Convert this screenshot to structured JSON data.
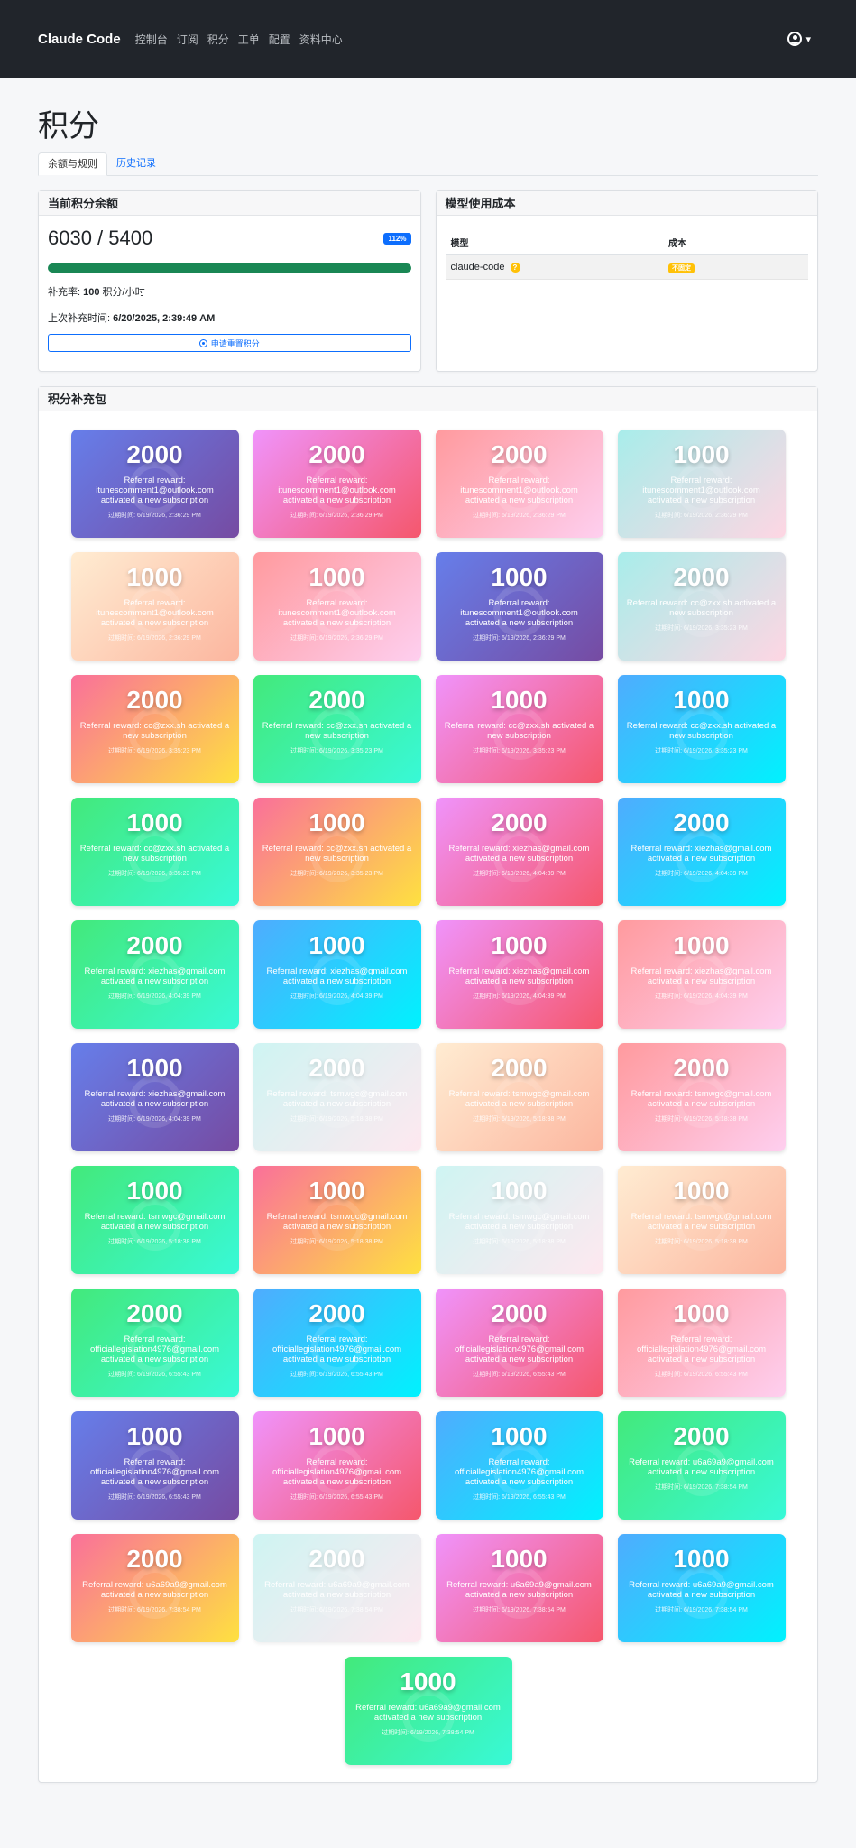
{
  "nav": {
    "brand": "Claude Code",
    "links": [
      "控制台",
      "订阅",
      "积分",
      "工单",
      "配置",
      "资料中心"
    ]
  },
  "page": {
    "title": "积分",
    "tabs": [
      "余额与规则",
      "历史记录"
    ]
  },
  "balance_card": {
    "header": "当前积分余额",
    "balance": "6030 / 5400",
    "percent_badge": "112%",
    "progress_fraction": 1.0,
    "rate_label": "补充率:",
    "rate_value": "100",
    "rate_unit": "积分/小时",
    "last_refill_label": "上次补充时间:",
    "last_refill_value": "6/20/2025, 2:39:49 AM",
    "reset_button": "申请重置积分"
  },
  "cost_card": {
    "header": "模型使用成本",
    "col_model": "模型",
    "col_cost": "成本",
    "rows": [
      {
        "model": "claude-code",
        "help": "?",
        "cost": "不固定"
      }
    ]
  },
  "packs": {
    "header": "积分补充包",
    "items": [
      {
        "amount": "2000",
        "desc": "Referral reward: itunescomment1@outlook.com activated a new subscription",
        "expiry": "过期时间: 6/19/2026, 2:36:29 PM",
        "g": "purple",
        "muted": false
      },
      {
        "amount": "2000",
        "desc": "Referral reward: itunescomment1@outlook.com activated a new subscription",
        "expiry": "过期时间: 6/19/2026, 2:36:29 PM",
        "g": "magenta",
        "muted": false
      },
      {
        "amount": "2000",
        "desc": "Referral reward: itunescomment1@outlook.com activated a new subscription",
        "expiry": "过期时间: 6/19/2026, 2:36:29 PM",
        "g": "pink",
        "muted": false
      },
      {
        "amount": "1000",
        "desc": "Referral reward: itunescomment1@outlook.com activated a new subscription",
        "expiry": "过期时间: 6/19/2026, 2:36:29 PM",
        "g": "mint",
        "muted": false
      },
      {
        "amount": "1000",
        "desc": "Referral reward: itunescomment1@outlook.com activated a new subscription",
        "expiry": "过期时间: 6/19/2026, 2:36:29 PM",
        "g": "peach",
        "muted": false
      },
      {
        "amount": "1000",
        "desc": "Referral reward: itunescomment1@outlook.com activated a new subscription",
        "expiry": "过期时间: 6/19/2026, 2:36:29 PM",
        "g": "pink",
        "muted": false
      },
      {
        "amount": "1000",
        "desc": "Referral reward: itunescomment1@outlook.com activated a new subscription",
        "expiry": "过期时间: 6/19/2026, 2:36:29 PM",
        "g": "purple",
        "muted": false
      },
      {
        "amount": "2000",
        "desc": "Referral reward: cc@zxx.sh activated a new subscription",
        "expiry": "过期时间: 6/19/2026, 3:35:23 PM",
        "g": "mint",
        "muted": false
      },
      {
        "amount": "2000",
        "desc": "Referral reward: cc@zxx.sh activated a new subscription",
        "expiry": "过期时间: 6/19/2026, 3:35:23 PM",
        "g": "sunset",
        "muted": false
      },
      {
        "amount": "2000",
        "desc": "Referral reward: cc@zxx.sh activated a new subscription",
        "expiry": "过期时间: 6/19/2026, 3:35:23 PM",
        "g": "green",
        "muted": false
      },
      {
        "amount": "1000",
        "desc": "Referral reward: cc@zxx.sh activated a new subscription",
        "expiry": "过期时间: 6/19/2026, 3:35:23 PM",
        "g": "magenta",
        "muted": false
      },
      {
        "amount": "1000",
        "desc": "Referral reward: cc@zxx.sh activated a new subscription",
        "expiry": "过期时间: 6/19/2026, 3:35:23 PM",
        "g": "cyan",
        "muted": false
      },
      {
        "amount": "1000",
        "desc": "Referral reward: cc@zxx.sh activated a new subscription",
        "expiry": "过期时间: 6/19/2026, 3:35:23 PM",
        "g": "green",
        "muted": false
      },
      {
        "amount": "1000",
        "desc": "Referral reward: cc@zxx.sh activated a new subscription",
        "expiry": "过期时间: 6/19/2026, 3:35:23 PM",
        "g": "sunset",
        "muted": false
      },
      {
        "amount": "2000",
        "desc": "Referral reward: xiezhas@gmail.com activated a new subscription",
        "expiry": "过期时间: 6/19/2026, 4:04:39 PM",
        "g": "magenta",
        "muted": false
      },
      {
        "amount": "2000",
        "desc": "Referral reward: xiezhas@gmail.com activated a new subscription",
        "expiry": "过期时间: 6/19/2026, 4:04:39 PM",
        "g": "cyan",
        "muted": false
      },
      {
        "amount": "2000",
        "desc": "Referral reward: xiezhas@gmail.com activated a new subscription",
        "expiry": "过期时间: 6/19/2026, 4:04:39 PM",
        "g": "green",
        "muted": false
      },
      {
        "amount": "1000",
        "desc": "Referral reward: xiezhas@gmail.com activated a new subscription",
        "expiry": "过期时间: 6/19/2026, 4:04:39 PM",
        "g": "cyan",
        "muted": false
      },
      {
        "amount": "1000",
        "desc": "Referral reward: xiezhas@gmail.com activated a new subscription",
        "expiry": "过期时间: 6/19/2026, 4:04:39 PM",
        "g": "magenta",
        "muted": false
      },
      {
        "amount": "1000",
        "desc": "Referral reward: xiezhas@gmail.com activated a new subscription",
        "expiry": "过期时间: 6/19/2026, 4:04:39 PM",
        "g": "pink",
        "muted": false
      },
      {
        "amount": "1000",
        "desc": "Referral reward: xiezhas@gmail.com activated a new subscription",
        "expiry": "过期时间: 6/19/2026, 4:04:39 PM",
        "g": "purple",
        "muted": false
      },
      {
        "amount": "2000",
        "desc": "Referral reward: tsmwgc@gmail.com activated a new subscription",
        "expiry": "过期时间: 6/19/2026, 5:18:38 PM",
        "g": "mint",
        "muted": true
      },
      {
        "amount": "2000",
        "desc": "Referral reward: tsmwgc@gmail.com activated a new subscription",
        "expiry": "过期时间: 6/19/2026, 5:18:38 PM",
        "g": "peach",
        "muted": false
      },
      {
        "amount": "2000",
        "desc": "Referral reward: tsmwgc@gmail.com activated a new subscription",
        "expiry": "过期时间: 6/19/2026, 5:18:38 PM",
        "g": "pink",
        "muted": false
      },
      {
        "amount": "1000",
        "desc": "Referral reward: tsmwgc@gmail.com activated a new subscription",
        "expiry": "过期时间: 6/19/2026, 5:18:38 PM",
        "g": "green",
        "muted": false
      },
      {
        "amount": "1000",
        "desc": "Referral reward: tsmwgc@gmail.com activated a new subscription",
        "expiry": "过期时间: 6/19/2026, 5:18:38 PM",
        "g": "sunset",
        "muted": false
      },
      {
        "amount": "1000",
        "desc": "Referral reward: tsmwgc@gmail.com activated a new subscription",
        "expiry": "过期时间: 6/19/2026, 5:18:38 PM",
        "g": "mint",
        "muted": true
      },
      {
        "amount": "1000",
        "desc": "Referral reward: tsmwgc@gmail.com activated a new subscription",
        "expiry": "过期时间: 6/19/2026, 5:18:38 PM",
        "g": "peach",
        "muted": false
      },
      {
        "amount": "2000",
        "desc": "Referral reward: officiallegislation4976@gmail.com activated a new subscription",
        "expiry": "过期时间: 6/19/2026, 6:55:43 PM",
        "g": "green",
        "muted": false
      },
      {
        "amount": "2000",
        "desc": "Referral reward: officiallegislation4976@gmail.com activated a new subscription",
        "expiry": "过期时间: 6/19/2026, 6:55:43 PM",
        "g": "cyan",
        "muted": false
      },
      {
        "amount": "2000",
        "desc": "Referral reward: officiallegislation4976@gmail.com activated a new subscription",
        "expiry": "过期时间: 6/19/2026, 6:55:43 PM",
        "g": "magenta",
        "muted": false
      },
      {
        "amount": "1000",
        "desc": "Referral reward: officiallegislation4976@gmail.com activated a new subscription",
        "expiry": "过期时间: 6/19/2026, 6:55:43 PM",
        "g": "pink",
        "muted": false
      },
      {
        "amount": "1000",
        "desc": "Referral reward: officiallegislation4976@gmail.com activated a new subscription",
        "expiry": "过期时间: 6/19/2026, 6:55:43 PM",
        "g": "purple",
        "muted": false
      },
      {
        "amount": "1000",
        "desc": "Referral reward: officiallegislation4976@gmail.com activated a new subscription",
        "expiry": "过期时间: 6/19/2026, 6:55:43 PM",
        "g": "magenta",
        "muted": false
      },
      {
        "amount": "1000",
        "desc": "Referral reward: officiallegislation4976@gmail.com activated a new subscription",
        "expiry": "过期时间: 6/19/2026, 6:55:43 PM",
        "g": "cyan",
        "muted": false
      },
      {
        "amount": "2000",
        "desc": "Referral reward: u6a69a9@gmail.com activated a new subscription",
        "expiry": "过期时间: 6/19/2026, 7:38:54 PM",
        "g": "green",
        "muted": false
      },
      {
        "amount": "2000",
        "desc": "Referral reward: u6a69a9@gmail.com activated a new subscription",
        "expiry": "过期时间: 6/19/2026, 7:38:54 PM",
        "g": "sunset",
        "muted": false
      },
      {
        "amount": "2000",
        "desc": "Referral reward: u6a69a9@gmail.com activated a new subscription",
        "expiry": "过期时间: 6/19/2026, 7:38:54 PM",
        "g": "mint",
        "muted": true
      },
      {
        "amount": "1000",
        "desc": "Referral reward: u6a69a9@gmail.com activated a new subscription",
        "expiry": "过期时间: 6/19/2026, 7:38:54 PM",
        "g": "magenta",
        "muted": false
      },
      {
        "amount": "1000",
        "desc": "Referral reward: u6a69a9@gmail.com activated a new subscription",
        "expiry": "过期时间: 6/19/2026, 7:38:54 PM",
        "g": "cyan",
        "muted": false
      }
    ],
    "last": {
      "amount": "1000",
      "desc": "Referral reward: u6a69a9@gmail.com activated a new subscription",
      "expiry": "过期时间: 6/19/2026, 7:38:54 PM",
      "g": "green",
      "muted": false
    }
  },
  "colors": {
    "navbar_bg": "#21252b",
    "link": "#0d6efd",
    "progress": "#198754",
    "warning": "#ffc107",
    "gradients": {
      "purple": [
        "#667eea",
        "#764ba2"
      ],
      "magenta": [
        "#f093fb",
        "#f5576c"
      ],
      "pink": [
        "#ff9a9e",
        "#fecfef"
      ],
      "mint": [
        "#a8edea",
        "#fed6e3"
      ],
      "peach": [
        "#ffecd2",
        "#fcb69f"
      ],
      "sunset": [
        "#fa709a",
        "#fee140"
      ],
      "green": [
        "#43e97b",
        "#38f9d7"
      ],
      "cyan": [
        "#4facfe",
        "#00f2fe"
      ]
    }
  }
}
